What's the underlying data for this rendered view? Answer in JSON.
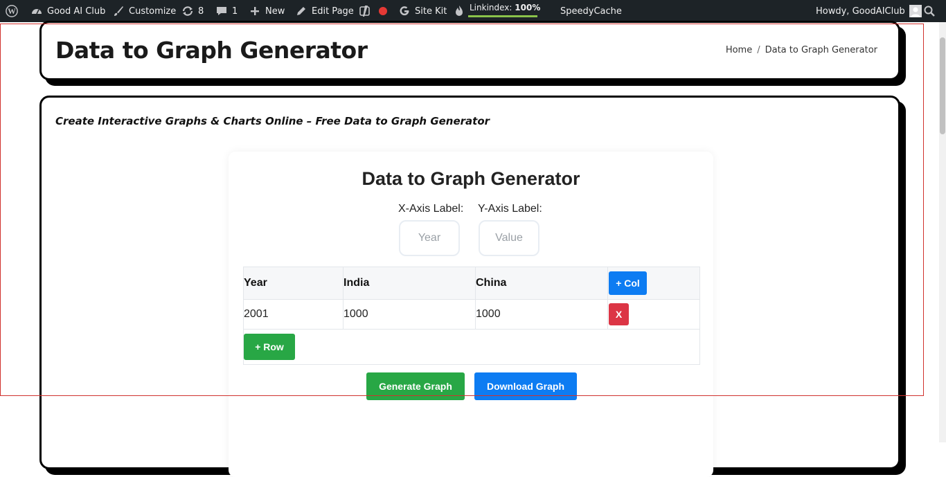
{
  "admin_bar": {
    "site_name": "Good AI Club",
    "customize": "Customize",
    "updates_count": "8",
    "comments_count": "1",
    "new_label": "New",
    "edit_page": "Edit Page",
    "site_kit": "Site Kit",
    "linkindex_label": "Linkindex:",
    "linkindex_value": "100%",
    "speedycache": "SpeedyCache",
    "howdy": "Howdy, GoodAIClub"
  },
  "header": {
    "title": "Data to Graph Generator",
    "breadcrumb": {
      "home": "Home",
      "separator": "/",
      "current": "Data to Graph Generator"
    }
  },
  "content": {
    "tagline": "Create Interactive Graphs & Charts Online – Free Data to Graph Generator"
  },
  "tool": {
    "title": "Data to Graph Generator",
    "x_label": "X-Axis Label:",
    "y_label": "Y-Axis Label:",
    "x_placeholder": "Year",
    "y_placeholder": "Value",
    "headers": [
      "Year",
      "India",
      "China"
    ],
    "rows": [
      [
        "2001",
        "1000",
        "1000"
      ]
    ],
    "add_col": "+ Col",
    "delete_row": "X",
    "add_row": "+ Row",
    "generate": "Generate Graph",
    "download": "Download Graph"
  },
  "colors": {
    "admin_bar_bg": "#1d2327",
    "primary_blue": "#0d7cf2",
    "success_green": "#28a745",
    "danger_red": "#dc3545",
    "recording_dot": "#e53935",
    "linkindex_bar": "#8bc34a",
    "selection_rect": "#d0312d"
  }
}
